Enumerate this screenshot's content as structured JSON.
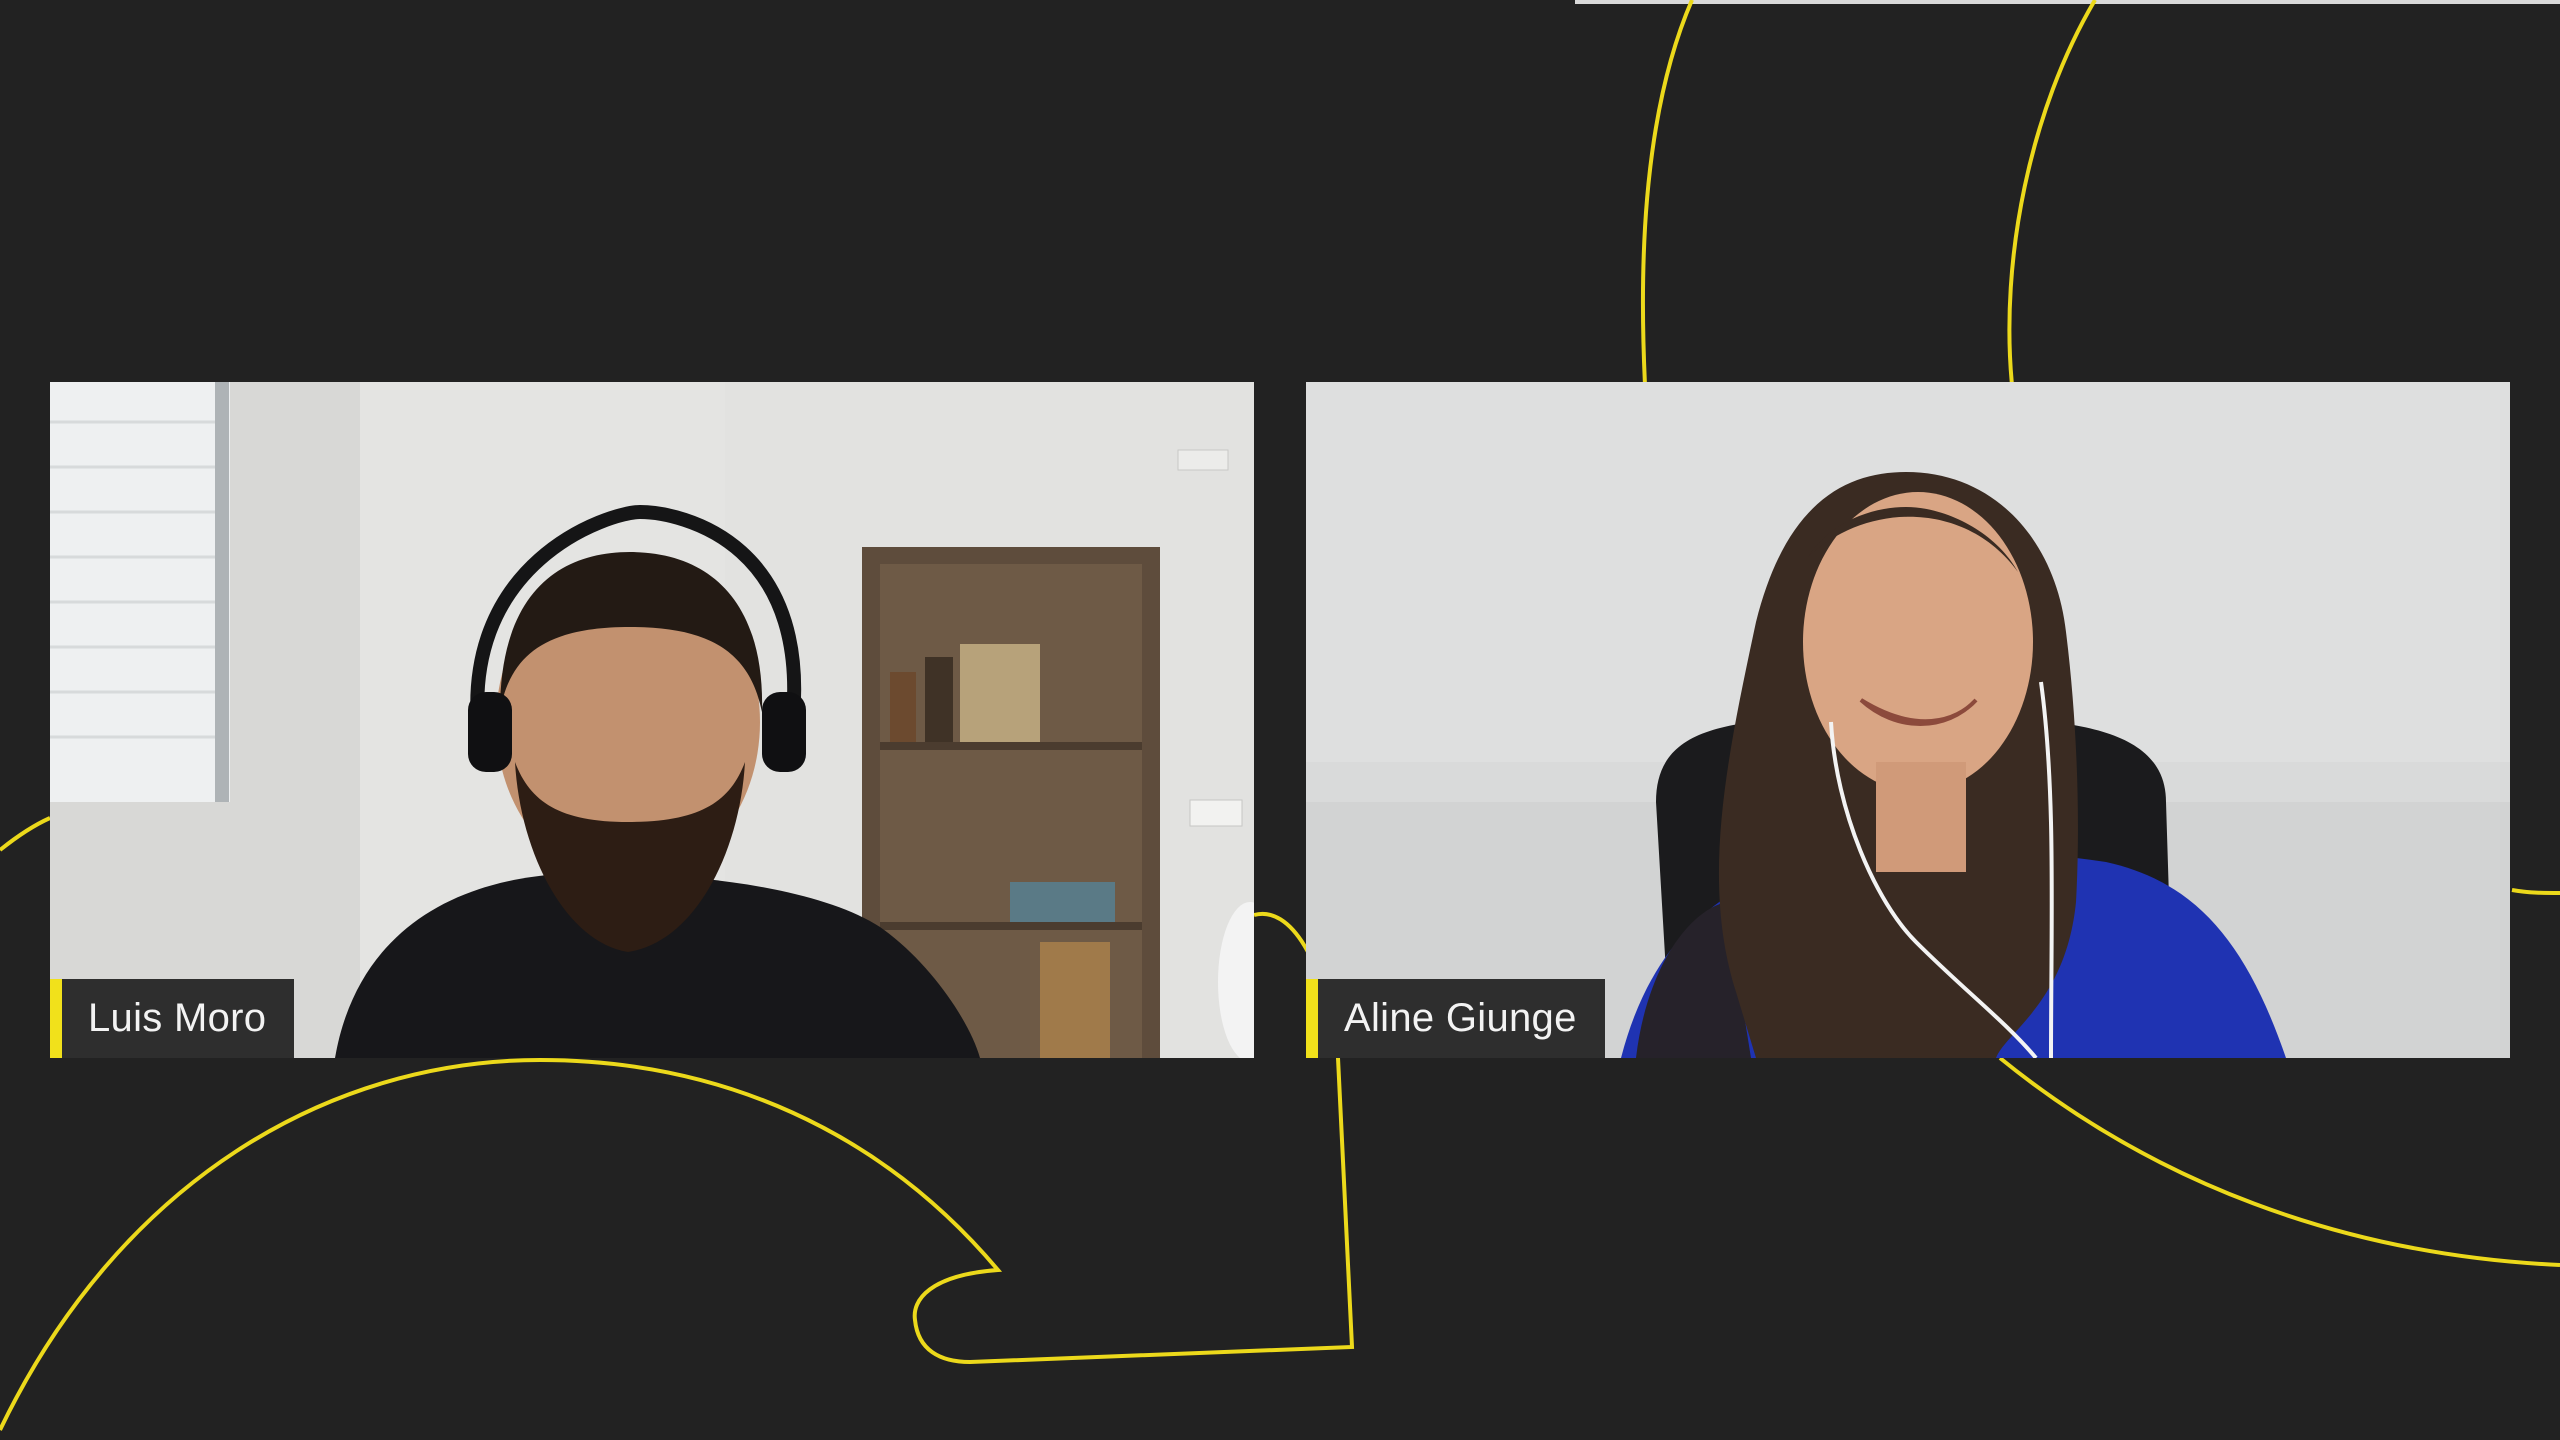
{
  "participants": [
    {
      "id": "luis",
      "name": "Luis Moro"
    },
    {
      "id": "aline",
      "name": "Aline Giunge"
    }
  ],
  "colors": {
    "background": "#222222",
    "accent": "#f1e11b",
    "name_tag_bg": "#202020",
    "name_text": "#f3f3f3"
  }
}
